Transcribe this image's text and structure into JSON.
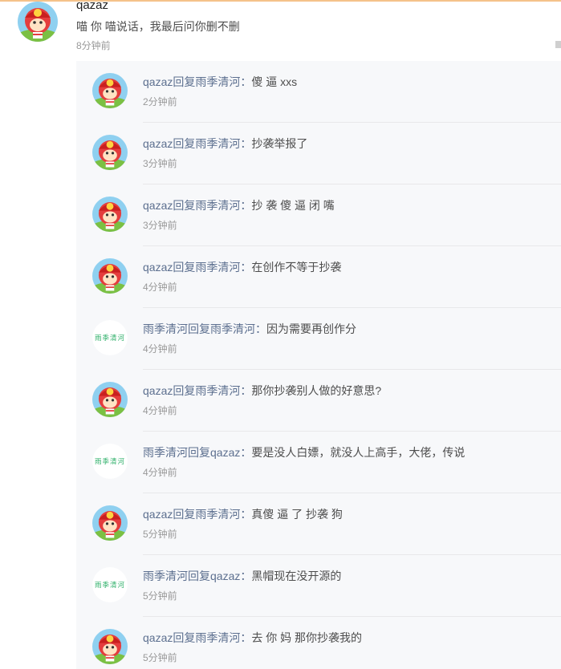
{
  "main_comment": {
    "username": "qazaz",
    "text": "喵 你 喵说话，我最后问你删不删",
    "time": "8分钟前",
    "avatar_icon": "cartoon-avatar"
  },
  "replies": [
    {
      "user": "qazaz",
      "action": "回复",
      "target": "雨季清河",
      "sep": "：",
      "text": "傻 逼 xxs",
      "time": "2分钟前",
      "avatar": "cartoon"
    },
    {
      "user": "qazaz",
      "action": "回复",
      "target": "雨季清河",
      "sep": "：",
      "text": "抄袭举报了",
      "time": "3分钟前",
      "avatar": "cartoon"
    },
    {
      "user": "qazaz",
      "action": "回复",
      "target": "雨季清河",
      "sep": "：",
      "text": "抄 袭 傻 逼 闭 嘴",
      "time": "3分钟前",
      "avatar": "cartoon"
    },
    {
      "user": "qazaz",
      "action": "回复",
      "target": "雨季清河",
      "sep": "：",
      "text": "在创作不等于抄袭",
      "time": "4分钟前",
      "avatar": "cartoon"
    },
    {
      "user": "雨季清河",
      "action": "回复",
      "target": "雨季清河",
      "sep": "：",
      "text": "因为需要再创作分",
      "time": "4分钟前",
      "avatar": "text"
    },
    {
      "user": "qazaz",
      "action": "回复",
      "target": "雨季清河",
      "sep": "：",
      "text": "那你抄袭别人做的好意思?",
      "time": "4分钟前",
      "avatar": "cartoon"
    },
    {
      "user": "雨季清河",
      "action": "回复",
      "target": "qazaz",
      "sep": "：",
      "text": "要是没人白嫖，就没人上高手，大佬，传说",
      "time": "4分钟前",
      "avatar": "text"
    },
    {
      "user": "qazaz",
      "action": "回复",
      "target": "雨季清河",
      "sep": "：",
      "text": "真傻 逼 了 抄袭 狗",
      "time": "5分钟前",
      "avatar": "cartoon"
    },
    {
      "user": "雨季清河",
      "action": "回复",
      "target": "qazaz",
      "sep": "：",
      "text": "黑帽现在没开源的",
      "time": "5分钟前",
      "avatar": "text"
    },
    {
      "user": "qazaz",
      "action": "回复",
      "target": "雨季清河",
      "sep": "：",
      "text": "去 你 妈 那你抄袭我的",
      "time": "5分钟前",
      "avatar": "cartoon"
    }
  ],
  "text_avatar_label": "雨季清河",
  "colors": {
    "username_link": "#5c6f8f",
    "body_text": "#4d4d4d",
    "time_text": "#999999",
    "panel_bg": "#f7f8fa",
    "text_avatar_green": "#2fb06a"
  }
}
